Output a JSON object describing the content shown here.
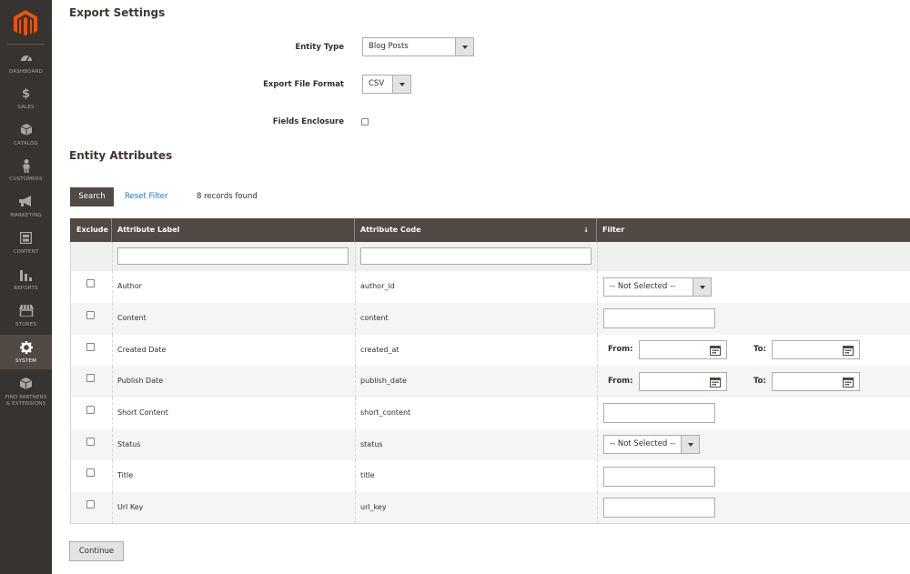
{
  "sidebar": {
    "items": [
      {
        "label": "DASHBOARD",
        "icon": "dashboard-icon"
      },
      {
        "label": "SALES",
        "icon": "dollar-icon"
      },
      {
        "label": "CATALOG",
        "icon": "box-icon"
      },
      {
        "label": "CUSTOMERS",
        "icon": "person-icon"
      },
      {
        "label": "MARKETING",
        "icon": "megaphone-icon"
      },
      {
        "label": "CONTENT",
        "icon": "layout-icon"
      },
      {
        "label": "REPORTS",
        "icon": "bar-chart-icon"
      },
      {
        "label": "STORES",
        "icon": "store-icon"
      },
      {
        "label": "SYSTEM",
        "icon": "gear-icon"
      },
      {
        "label": "FIND PARTNERS",
        "label2": "& EXTENSIONS",
        "icon": "extensions-icon"
      }
    ],
    "active": "SYSTEM",
    "accent_color": "#eb5202"
  },
  "export_settings": {
    "title": "Export Settings",
    "entity_type_label": "Entity Type",
    "entity_type_value": "Blog Posts",
    "file_format_label": "Export File Format",
    "file_format_value": "CSV",
    "fields_enclosure_label": "Fields Enclosure"
  },
  "entity_attributes": {
    "title": "Entity Attributes",
    "search_label": "Search",
    "reset_filter_label": "Reset Filter",
    "records_found": "8 records found",
    "columns": {
      "exclude": "Exclude",
      "attribute_label": "Attribute Label",
      "attribute_code": "Attribute Code",
      "sort_indicator": "↓",
      "filter": "Filter"
    },
    "rows": [
      {
        "label": "Author",
        "code": "author_id",
        "filter": "select",
        "filter_value": "-- Not Selected --"
      },
      {
        "label": "Content",
        "code": "content",
        "filter": "text"
      },
      {
        "label": "Created Date",
        "code": "created_at",
        "filter": "date"
      },
      {
        "label": "Publish Date",
        "code": "publish_date",
        "filter": "date"
      },
      {
        "label": "Short Content",
        "code": "short_content",
        "filter": "text"
      },
      {
        "label": "Status",
        "code": "status",
        "filter": "select",
        "filter_value": "-- Not Selected --"
      },
      {
        "label": "Title",
        "code": "title",
        "filter": "text"
      },
      {
        "label": "Url Key",
        "code": "url_key",
        "filter": "text"
      }
    ],
    "from_label": "From:",
    "to_label": "To:"
  },
  "continue_label": "Continue"
}
